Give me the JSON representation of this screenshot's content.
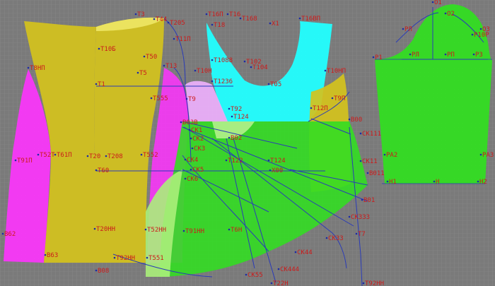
{
  "canvas": {
    "background": "#7f7f7f",
    "grid_color": "#8e8e8e",
    "label_color": "#cc1b1b",
    "line_color": "#2a3bb8"
  },
  "pieces": [
    {
      "name": "back-side-panel",
      "color": "#ff33ff"
    },
    {
      "name": "back-panel-left",
      "color": "#d4c21c"
    },
    {
      "name": "back-panel-right",
      "color": "#d4c21c"
    },
    {
      "name": "side-panel",
      "color": "#ff33ff"
    },
    {
      "name": "front-top",
      "color": "#22ffff"
    },
    {
      "name": "front-side",
      "color": "#d4c21c"
    },
    {
      "name": "skirt-wedge",
      "color": "#33dd22"
    },
    {
      "name": "skirt-wedge-light",
      "color": "#aaf07a"
    },
    {
      "name": "sleeve",
      "color": "#33dd22"
    }
  ],
  "labels": [
    {
      "id": "l-t3",
      "text": "T3"
    },
    {
      "id": "l-t44",
      "text": "T44"
    },
    {
      "id": "l-t205",
      "text": "T205"
    },
    {
      "id": "l-t16p-a",
      "text": "T16П"
    },
    {
      "id": "l-t16",
      "text": "T16"
    },
    {
      "id": "l-t168",
      "text": "T168"
    },
    {
      "id": "l-t16bp",
      "text": "T16ВП"
    },
    {
      "id": "l-x1",
      "text": "X1"
    },
    {
      "id": "l-t18",
      "text": "T18"
    },
    {
      "id": "l-t11p",
      "text": "T11П"
    },
    {
      "id": "l-t10b",
      "text": "T10Б"
    },
    {
      "id": "l-t50",
      "text": "T50"
    },
    {
      "id": "l-t5",
      "text": "T5"
    },
    {
      "id": "l-t8np",
      "text": "T8НП"
    },
    {
      "id": "l-t10n",
      "text": "T10Н"
    },
    {
      "id": "l-t1088",
      "text": "T1088"
    },
    {
      "id": "l-t102",
      "text": "T102"
    },
    {
      "id": "l-t104",
      "text": "T104"
    },
    {
      "id": "l-t1236",
      "text": "T1236"
    },
    {
      "id": "l-t05",
      "text": "T05"
    },
    {
      "id": "l-t10np",
      "text": "T10НП"
    },
    {
      "id": "l-t9p",
      "text": "T9П"
    },
    {
      "id": "l-t12p",
      "text": "T12П"
    },
    {
      "id": "l-t555",
      "text": "T555"
    },
    {
      "id": "l-t9",
      "text": "T9"
    },
    {
      "id": "l-t92",
      "text": "T92"
    },
    {
      "id": "l-t124",
      "text": "T124"
    },
    {
      "id": "l-b00",
      "text": "B00"
    },
    {
      "id": "l-b03b",
      "text": "B03B"
    },
    {
      "id": "l-ck1",
      "text": "CK1"
    },
    {
      "id": "l-ck2",
      "text": "CK2"
    },
    {
      "id": "l-ck3",
      "text": "CK3"
    },
    {
      "id": "l-ck4",
      "text": "CK4"
    },
    {
      "id": "l-ck5",
      "text": "CK5"
    },
    {
      "id": "l-ck6",
      "text": "CK6"
    },
    {
      "id": "l-b02",
      "text": "B02"
    },
    {
      "id": "l-ck111",
      "text": "CK111"
    },
    {
      "id": "l-t91p",
      "text": "T91П"
    },
    {
      "id": "l-t52",
      "text": "T52T"
    },
    {
      "id": "l-t61p",
      "text": "T61П"
    },
    {
      "id": "l-t20",
      "text": "T20"
    },
    {
      "id": "l-t208",
      "text": "T208"
    },
    {
      "id": "l-t552",
      "text": "T552"
    },
    {
      "id": "l-t60",
      "text": "T60"
    },
    {
      "id": "l-t122",
      "text": "T122"
    },
    {
      "id": "l-x00",
      "text": "X00"
    },
    {
      "id": "l-t124b",
      "text": "T124"
    },
    {
      "id": "l-ck11",
      "text": "CK11"
    },
    {
      "id": "l-b011",
      "text": "B011"
    },
    {
      "id": "l-b01",
      "text": "B01"
    },
    {
      "id": "l-ck333",
      "text": "CK333"
    },
    {
      "id": "l-ck33",
      "text": "CK33"
    },
    {
      "id": "l-ck44",
      "text": "CK44"
    },
    {
      "id": "l-ck444",
      "text": "CK444"
    },
    {
      "id": "l-ck55",
      "text": "CK55"
    },
    {
      "id": "l-t7",
      "text": "T7"
    },
    {
      "id": "l-b62",
      "text": "B62"
    },
    {
      "id": "l-b63",
      "text": "B63"
    },
    {
      "id": "l-t92nn",
      "text": "T92НН"
    },
    {
      "id": "l-t551",
      "text": "T551"
    },
    {
      "id": "l-b08",
      "text": "B08"
    },
    {
      "id": "l-t20hh",
      "text": "T20НН"
    },
    {
      "id": "l-t52nn",
      "text": "T52НН"
    },
    {
      "id": "l-t91nn",
      "text": "T91НН"
    },
    {
      "id": "l-t6h",
      "text": "T6Н"
    },
    {
      "id": "l-t92nn2",
      "text": "T92НН"
    },
    {
      "id": "l-t22h",
      "text": "T22Н"
    },
    {
      "id": "l-p1",
      "text": "P1"
    },
    {
      "id": "l-pl",
      "text": "PЛ"
    },
    {
      "id": "l-pp",
      "text": "PП"
    },
    {
      "id": "l-p3",
      "text": "P3"
    },
    {
      "id": "l-o2",
      "text": "O2"
    },
    {
      "id": "l-rl",
      "text": "PЛ"
    },
    {
      "id": "l-p10p",
      "text": "P10P"
    },
    {
      "id": "l-o1",
      "text": "O1"
    },
    {
      "id": "l-o3",
      "text": "O3"
    },
    {
      "id": "l-ra2",
      "text": "PA2"
    },
    {
      "id": "l-ra3",
      "text": "PA3"
    },
    {
      "id": "l-h1",
      "text": "H1"
    },
    {
      "id": "l-h",
      "text": "H"
    },
    {
      "id": "l-h2",
      "text": "H2"
    },
    {
      "id": "l-t1",
      "text": "T1"
    },
    {
      "id": "l-t13",
      "text": "T13"
    }
  ]
}
